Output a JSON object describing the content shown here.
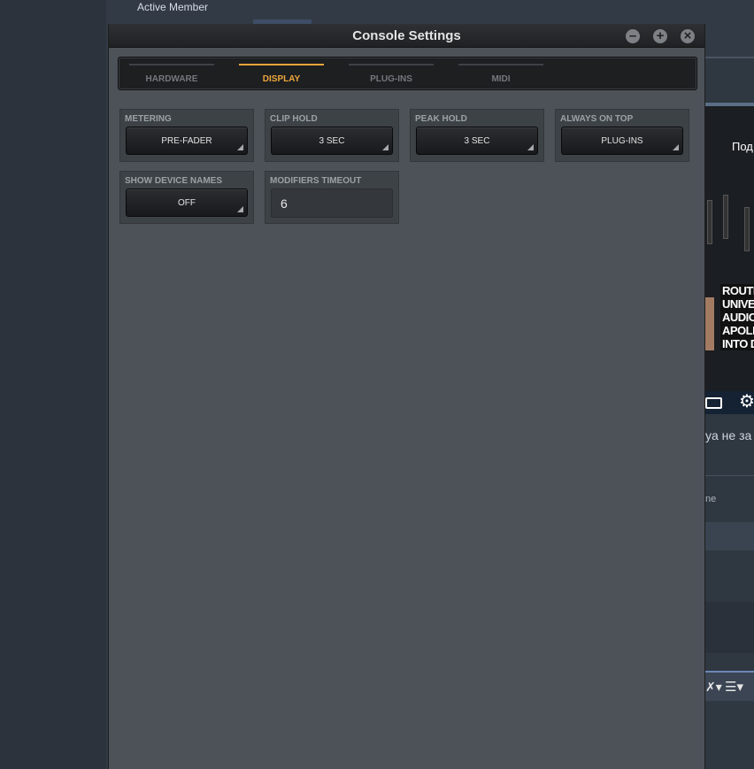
{
  "background": {
    "member_label": "Active Member",
    "video_title_fragment": "Под",
    "video_overlay_lines": [
      "ROUTIN",
      "UNIVER",
      "AUDIO'S",
      "APOLLO",
      "INTO DE"
    ],
    "comment_fragment": "ya не за",
    "meta_fragment": "ne"
  },
  "window": {
    "title": "Console Settings",
    "tabs": [
      {
        "label": "HARDWARE",
        "active": false
      },
      {
        "label": "DISPLAY",
        "active": true
      },
      {
        "label": "PLUG-INS",
        "active": false
      },
      {
        "label": "MIDI",
        "active": false
      }
    ],
    "settings": {
      "metering": {
        "label": "METERING",
        "value": "PRE-FADER"
      },
      "clip_hold": {
        "label": "CLIP HOLD",
        "value": "3 SEC"
      },
      "peak_hold": {
        "label": "PEAK HOLD",
        "value": "3 SEC"
      },
      "always_on_top": {
        "label": "ALWAYS ON TOP",
        "value": "PLUG-INS"
      },
      "show_device_names": {
        "label": "SHOW DEVICE NAMES",
        "value": "OFF"
      },
      "modifiers_timeout": {
        "label": "MODIFIERS TIMEOUT",
        "value": "6"
      }
    }
  },
  "colors": {
    "accent": "#eea63a",
    "window_bg": "#4c5258",
    "page_bg": "#2b323c"
  }
}
